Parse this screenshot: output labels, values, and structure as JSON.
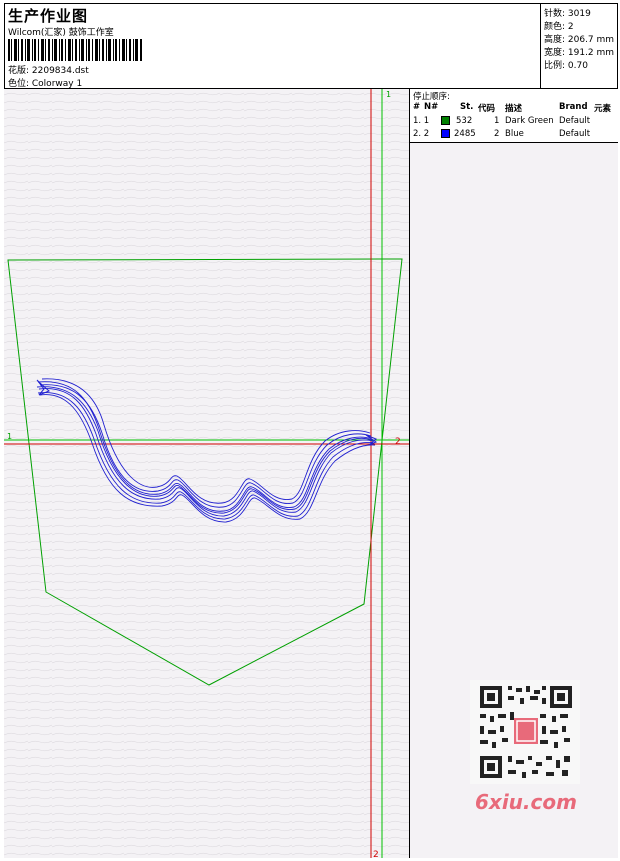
{
  "header": {
    "title": "生产作业图",
    "company": "Wilcom(汇家) 鼓饰工作室",
    "design_label": "花版: 2209834.dst",
    "colorway_label": "色位:  Colorway 1"
  },
  "stats": {
    "stitches": "针数: 3019",
    "colors": "颜色: 2",
    "height": "高度: 206.7 mm",
    "width": "宽度: 191.2 mm",
    "scale": "比例: 0.70"
  },
  "stop_sequence": {
    "title": "停止顺序:",
    "columns": [
      "#",
      "N#",
      "St.",
      "代码",
      "描述",
      "Brand",
      "元素"
    ],
    "rows": [
      {
        "idx": "1. 1",
        "color": "#008000",
        "stitches": "532",
        "code": "1",
        "desc": "Dark Green",
        "brand": "Default"
      },
      {
        "idx": "2. 2",
        "color": "#0000ff",
        "stitches": "2485",
        "code": "2",
        "desc": "Blue",
        "brand": "Default"
      }
    ]
  },
  "guides": {
    "top_green": "1",
    "left_green": "1",
    "right_red": "2",
    "bottom_red": "2"
  },
  "watermark": "6xiu.com",
  "colors": {
    "green": "#00a000",
    "red": "#d00000",
    "blue": "#2020d0"
  }
}
